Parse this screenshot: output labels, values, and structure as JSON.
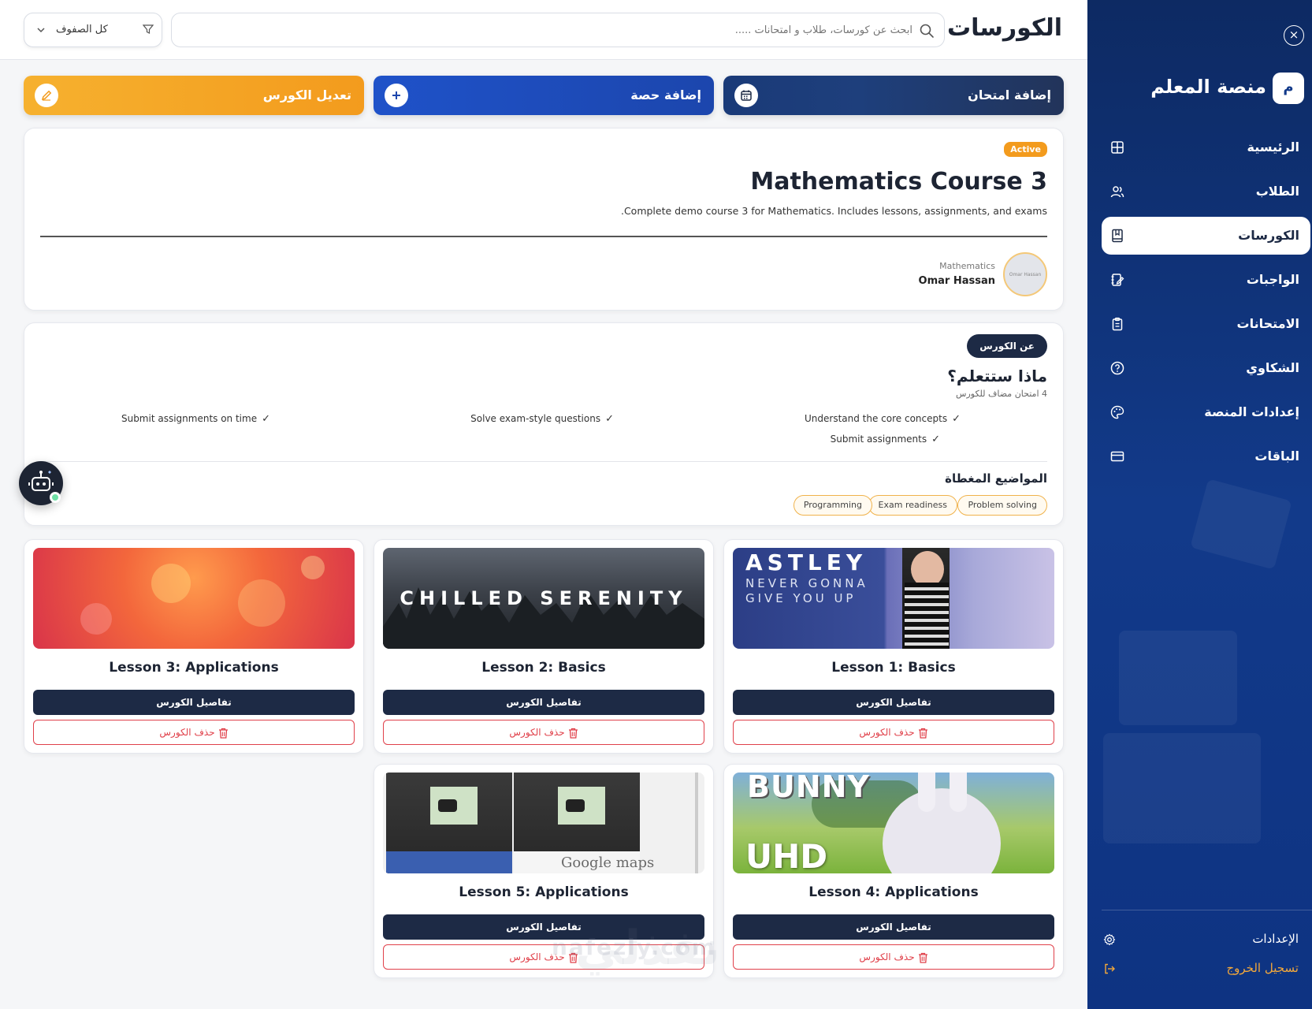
{
  "header": {
    "title": "الكورسات",
    "search_placeholder": "ابحث عن كورسات، طلاب و امتحانات .....",
    "filter_label": "كل الصفوف"
  },
  "actions": {
    "add_exam": "إضافة امتحان",
    "add_lesson": "إضافة حصة",
    "edit_course": "تعديل الكورس"
  },
  "course": {
    "status": "Active",
    "title": "Mathematics Course 3",
    "description": "Complete demo course 3 for Mathematics. Includes lessons, assignments, and exams.",
    "teacher_subject": "Mathematics",
    "teacher_name": "Omar Hassan",
    "avatar_text": "Omar Hassan"
  },
  "about": {
    "badge": "عن الكورس",
    "learn_title": "ماذا ستتعلم؟",
    "learn_subtitle": "4 امتحان مضاف للكورس",
    "learn_items": [
      "Understand the core concepts",
      "Solve exam-style questions",
      "Submit assignments on time",
      "Submit assignments"
    ],
    "topics_title": "المواضيع المغطاة",
    "topics": [
      "Problem solving",
      "Exam readiness",
      "Programming"
    ]
  },
  "lessons": [
    {
      "title": "Lesson 1: Basics",
      "thumb_text": "ASTLEY",
      "thumb_sub": "NEVER GONNA GIVE YOU UP"
    },
    {
      "title": "Lesson 2: Basics",
      "thumb_text": "CHILLED SERENITY"
    },
    {
      "title": "Lesson 3: Applications"
    },
    {
      "title": "Lesson 4: Applications",
      "thumb_text": "BUNNY",
      "thumb_sub": "UHD"
    },
    {
      "title": "Lesson 5: Applications",
      "thumb_text": "Google maps"
    }
  ],
  "lesson_buttons": {
    "details": "تفاصيل الكورس",
    "delete": "حذف الكورس"
  },
  "sidebar": {
    "logo_letter": "م",
    "brand": "منصة المعلم",
    "items": [
      {
        "label": "الرئيسية",
        "icon": "grid-icon"
      },
      {
        "label": "الطلاب",
        "icon": "users-icon"
      },
      {
        "label": "الكورسات",
        "icon": "book-icon",
        "active": true
      },
      {
        "label": "الواجبات",
        "icon": "notebook-edit-icon"
      },
      {
        "label": "الامتحانات",
        "icon": "clipboard-icon"
      },
      {
        "label": "الشكاوي",
        "icon": "help-circle-icon"
      },
      {
        "label": "إعدادات المنصة",
        "icon": "palette-icon"
      },
      {
        "label": "الباقات",
        "icon": "credit-card-icon"
      }
    ],
    "settings": "الإعدادات",
    "logout": "تسجيل الخروج"
  },
  "watermark": {
    "text": "nafezly.com",
    "text_ar": "نفذلي"
  },
  "colors": {
    "sidebar_bg": "#123a8a",
    "dark_navy": "#1d2a45",
    "orange": "#f39b1d",
    "blue": "#1f52c9",
    "danger": "#e0404a",
    "logout_orange": "#f4a93a"
  }
}
